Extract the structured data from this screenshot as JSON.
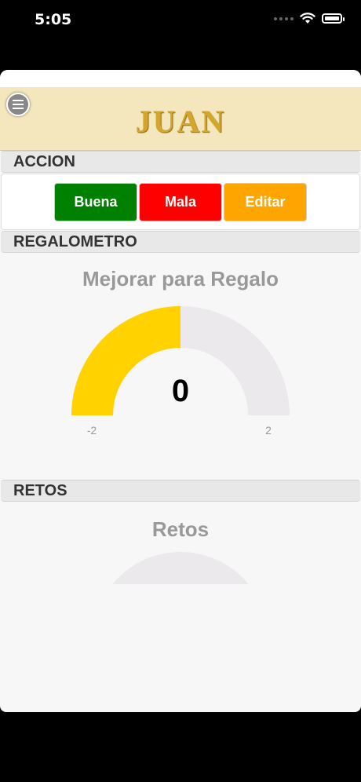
{
  "status_bar": {
    "time": "5:05"
  },
  "header": {
    "title": "JUAN"
  },
  "sections": {
    "accion": "ACCION",
    "regalometro": "REGALOMETRO",
    "retos": "RETOS"
  },
  "actions": {
    "buena": "Buena",
    "mala": "Mala",
    "editar": "Editar"
  },
  "colors": {
    "buena": "#008000",
    "mala": "#ff0000",
    "editar": "#ffa500",
    "gauge_fill": "#ffd200",
    "gauge_track": "#ece9ec",
    "header_bg": "#f4e7bd",
    "header_title": "#d4a62a"
  },
  "regalometro_gauge": {
    "title": "Mejorar para Regalo",
    "value": 0,
    "value_label": "0",
    "min": -2,
    "max": 2,
    "min_label": "-2",
    "max_label": "2"
  },
  "retos_gauge": {
    "title": "Retos"
  }
}
